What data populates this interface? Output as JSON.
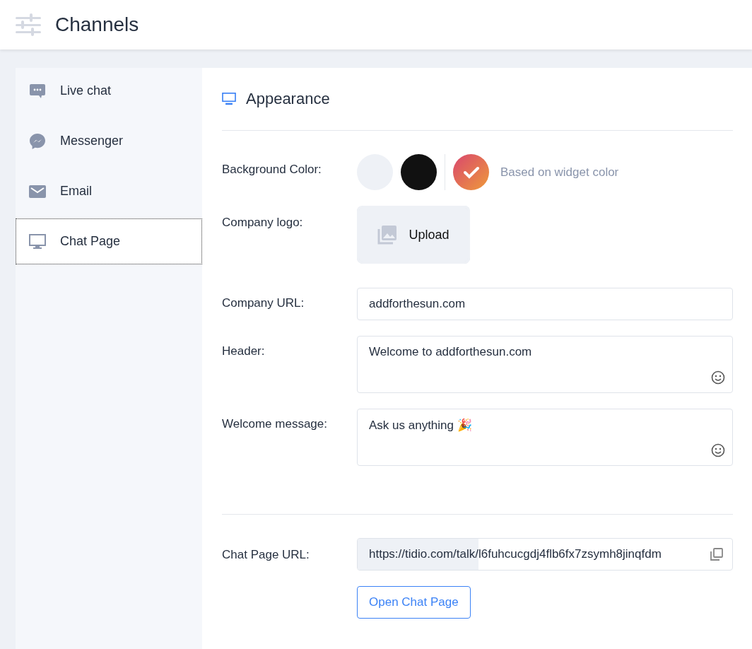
{
  "header": {
    "title": "Channels"
  },
  "sidebar": {
    "items": [
      {
        "label": "Live chat",
        "kind": "chat",
        "selected": false
      },
      {
        "label": "Messenger",
        "kind": "messenger",
        "selected": false
      },
      {
        "label": "Email",
        "kind": "email",
        "selected": false
      },
      {
        "label": "Chat Page",
        "kind": "monitor",
        "selected": true
      }
    ]
  },
  "section": {
    "title": "Appearance"
  },
  "background_color": {
    "label": "Background Color:",
    "options": [
      {
        "kind": "swatch",
        "color": "#eef1f6",
        "selected": false
      },
      {
        "kind": "swatch",
        "color": "#111111",
        "selected": false
      },
      {
        "kind": "gradient",
        "selected": true,
        "label": "Based on widget color"
      }
    ]
  },
  "company_logo": {
    "label": "Company logo:",
    "button": "Upload"
  },
  "fields": [
    {
      "kind": "input",
      "label": "Company URL:",
      "value": "addforthesun.com"
    },
    {
      "kind": "textarea",
      "label": "Header:",
      "value": "Welcome to addforthesun.com"
    },
    {
      "kind": "textarea",
      "label": "Welcome message:",
      "value": "Ask us anything 🎉"
    }
  ],
  "chat_page_url": {
    "label": "Chat Page URL:",
    "prefix": "https://tidio.com/talk/",
    "value": "l6fuhcucgdj4flb6fx7zsymh8jinqfdm",
    "button": "Open Chat Page"
  }
}
